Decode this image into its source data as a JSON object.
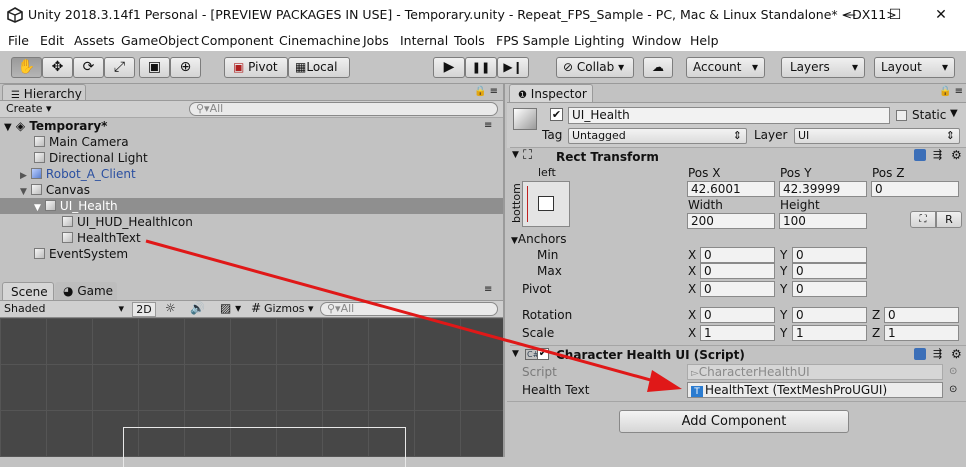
{
  "window": {
    "title": "Unity 2018.3.14f1 Personal - [PREVIEW PACKAGES IN USE] - Temporary.unity - Repeat_FPS_Sample - PC, Mac & Linux Standalone* <DX11>",
    "controls": {
      "minimize": "—",
      "maximize": "☐",
      "close": "✕"
    }
  },
  "menu": [
    "File",
    "Edit",
    "Assets",
    "GameObject",
    "Component",
    "Cinemachine",
    "Jobs",
    "Internal",
    "Tools",
    "FPS Sample",
    "Lighting",
    "Window",
    "Help"
  ],
  "toolbar": {
    "tools": [
      "✋",
      "✥",
      "⟳",
      "⤢",
      "▣",
      "⊕"
    ],
    "pivot": "Pivot",
    "local": "Local",
    "play": "▶",
    "pause": "❚❚",
    "step": "▶❙",
    "collab": "Collab ▾",
    "cloud": "☁",
    "account": "Account",
    "layers": "Layers",
    "layout": "Layout"
  },
  "hierarchy": {
    "tab": "Hierarchy",
    "create": "Create",
    "search_placeholder": "All",
    "scene": "Temporary*",
    "items": [
      "Main Camera",
      "Directional Light",
      "Robot_A_Client",
      "Canvas",
      "UI_Health",
      "UI_HUD_HealthIcon",
      "HealthText",
      "EventSystem"
    ]
  },
  "scene_view": {
    "tab_scene": "Scene",
    "tab_game": "Game",
    "shading": "Shaded",
    "mode_2d": "2D",
    "gizmos": "Gizmos",
    "search_placeholder": "All"
  },
  "inspector": {
    "tab": "Inspector",
    "object_name": "UI_Health",
    "static_label": "Static",
    "tag_label": "Tag",
    "tag_value": "Untagged",
    "layer_label": "Layer",
    "layer_value": "UI",
    "rect_transform": {
      "title": "Rect Transform",
      "anchor_h": "left",
      "anchor_v": "bottom",
      "pos_x_label": "Pos X",
      "pos_y_label": "Pos Y",
      "pos_z_label": "Pos Z",
      "pos_x": "42.6001",
      "pos_y": "42.39999",
      "pos_z": "0",
      "width_label": "Width",
      "height_label": "Height",
      "width": "200",
      "height": "100",
      "r_button": "R",
      "anchors_label": "Anchors",
      "min_label": "Min",
      "max_label": "Max",
      "min_x": "0",
      "min_y": "0",
      "max_x": "0",
      "max_y": "0",
      "pivot_label": "Pivot",
      "pivot_x": "0",
      "pivot_y": "0",
      "rotation_label": "Rotation",
      "rot_x": "0",
      "rot_y": "0",
      "rot_z": "0",
      "scale_label": "Scale",
      "scale_x": "1",
      "scale_y": "1",
      "scale_z": "1",
      "x": "X",
      "y": "Y",
      "z": "Z"
    },
    "script_component": {
      "title": "Character Health UI (Script)",
      "script_label": "Script",
      "script_value": "CharacterHealthUI",
      "health_text_label": "Health Text",
      "health_text_value": "HealthText (TextMeshProUGUI)"
    },
    "add_component": "Add Component"
  },
  "colors": {
    "arrow": "#e01818",
    "selection": "#8f8f8f",
    "prefab_blue": "#2a4fa0"
  }
}
